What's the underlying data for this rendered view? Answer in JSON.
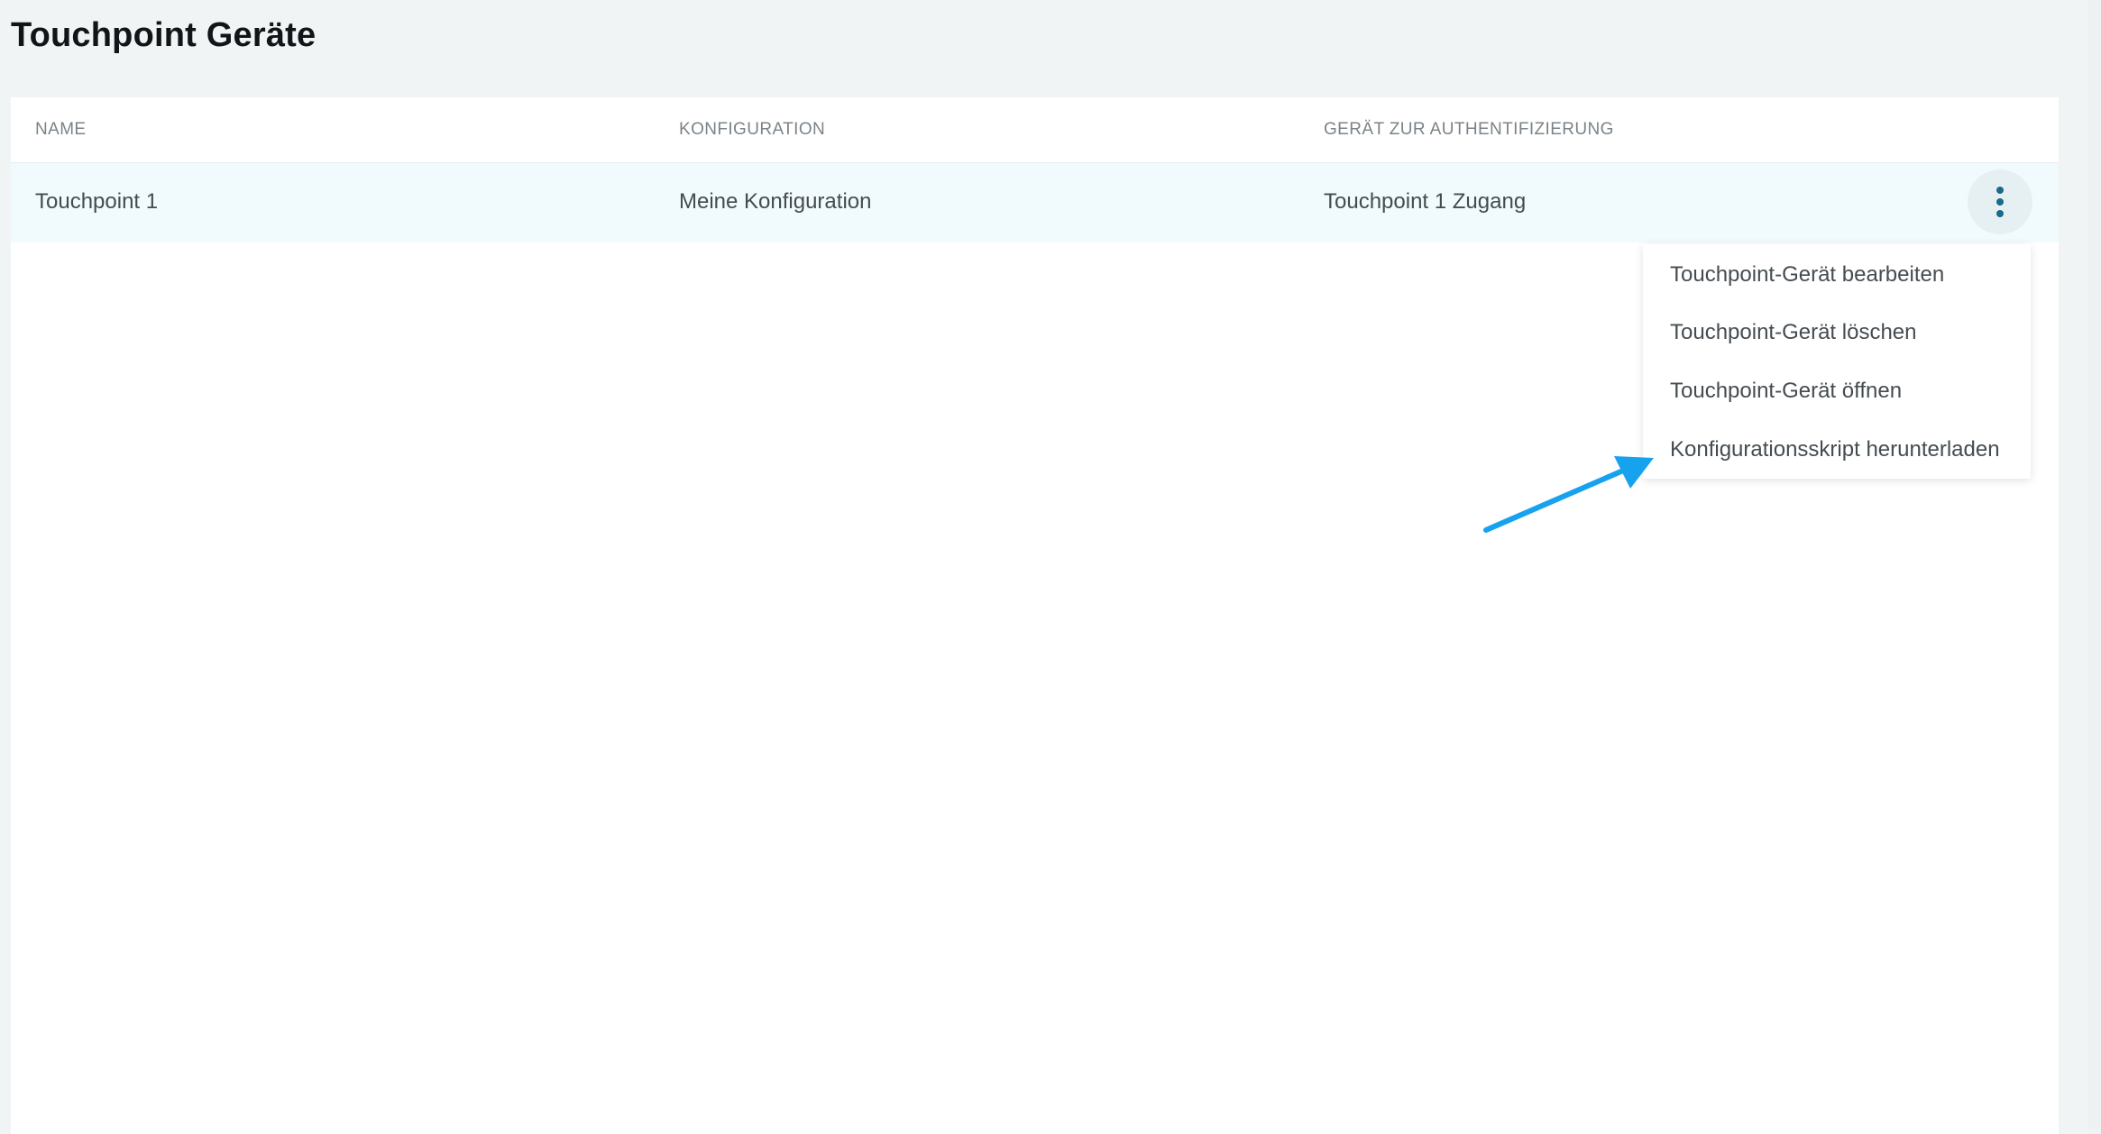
{
  "page": {
    "title": "Touchpoint Geräte"
  },
  "table": {
    "columns": [
      "NAME",
      "KONFIGURATION",
      "GERÄT ZUR AUTHENTIFIZIERUNG"
    ],
    "rows": [
      {
        "name": "Touchpoint 1",
        "configuration": "Meine Konfiguration",
        "auth_device": "Touchpoint 1 Zugang"
      }
    ]
  },
  "row_menu": {
    "icon": "more-vertical-icon",
    "items": [
      "Touchpoint-Gerät bearbeiten",
      "Touchpoint-Gerät löschen",
      "Touchpoint-Gerät öffnen",
      "Konfigurationsskript herunterladen"
    ]
  },
  "colors": {
    "background": "#f1f4f5",
    "row_highlight": "#f1fafc",
    "accent": "#1a6a8c",
    "annotation_arrow": "#16a2ee"
  }
}
